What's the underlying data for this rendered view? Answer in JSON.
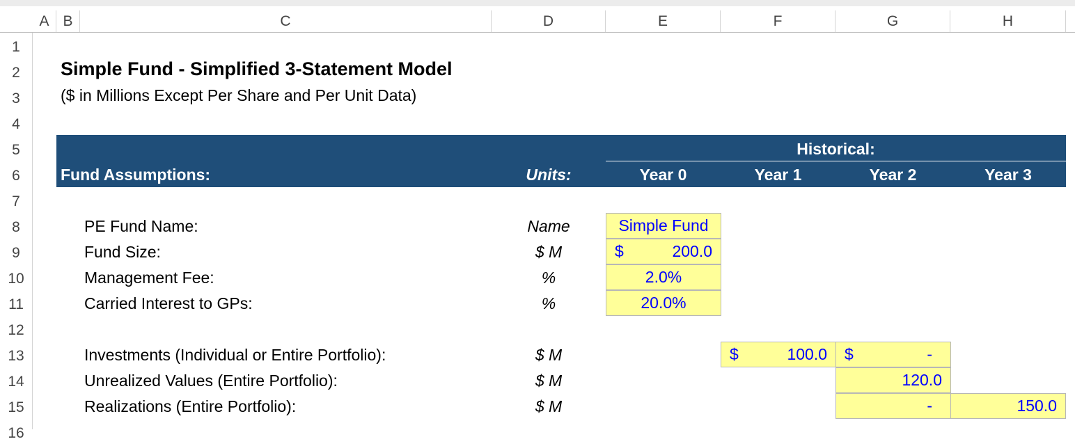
{
  "columns": [
    "A",
    "B",
    "C",
    "D",
    "E",
    "F",
    "G",
    "H"
  ],
  "rows": [
    "1",
    "2",
    "3",
    "4",
    "5",
    "6",
    "7",
    "8",
    "9",
    "10",
    "11",
    "12",
    "13",
    "14",
    "15",
    "16"
  ],
  "title": "Simple Fund - Simplified 3-Statement Model",
  "subtitle": "($ in Millions Except Per Share and Per Unit Data)",
  "header": {
    "section_label": "Fund Assumptions:",
    "units_label": "Units:",
    "historical_label": "Historical:",
    "years": [
      "Year 0",
      "Year 1",
      "Year 2",
      "Year 3"
    ]
  },
  "assumptions": [
    {
      "label": "PE Fund Name:",
      "unit": "Name",
      "value": "Simple Fund"
    },
    {
      "label": "Fund Size:",
      "unit": "$ M",
      "currency": "$",
      "value": "200.0"
    },
    {
      "label": "Management Fee:",
      "unit": "%",
      "value": "2.0%"
    },
    {
      "label": "Carried Interest to GPs:",
      "unit": "%",
      "value": "20.0%"
    }
  ],
  "portfolio": [
    {
      "label": "Investments (Individual or Entire Portfolio):",
      "unit": "$ M",
      "year1_currency": "$",
      "year1": "100.0",
      "year2_currency": "$",
      "year2": "-"
    },
    {
      "label": "Unrealized Values (Entire Portfolio):",
      "unit": "$ M",
      "year2": "120.0"
    },
    {
      "label": "Realizations (Entire Portfolio):",
      "unit": "$ M",
      "year2": "-",
      "year3": "150.0"
    }
  ],
  "colors": {
    "band": "#1f4e79",
    "input_fill": "#ffff99",
    "input_text": "#0000ff"
  }
}
